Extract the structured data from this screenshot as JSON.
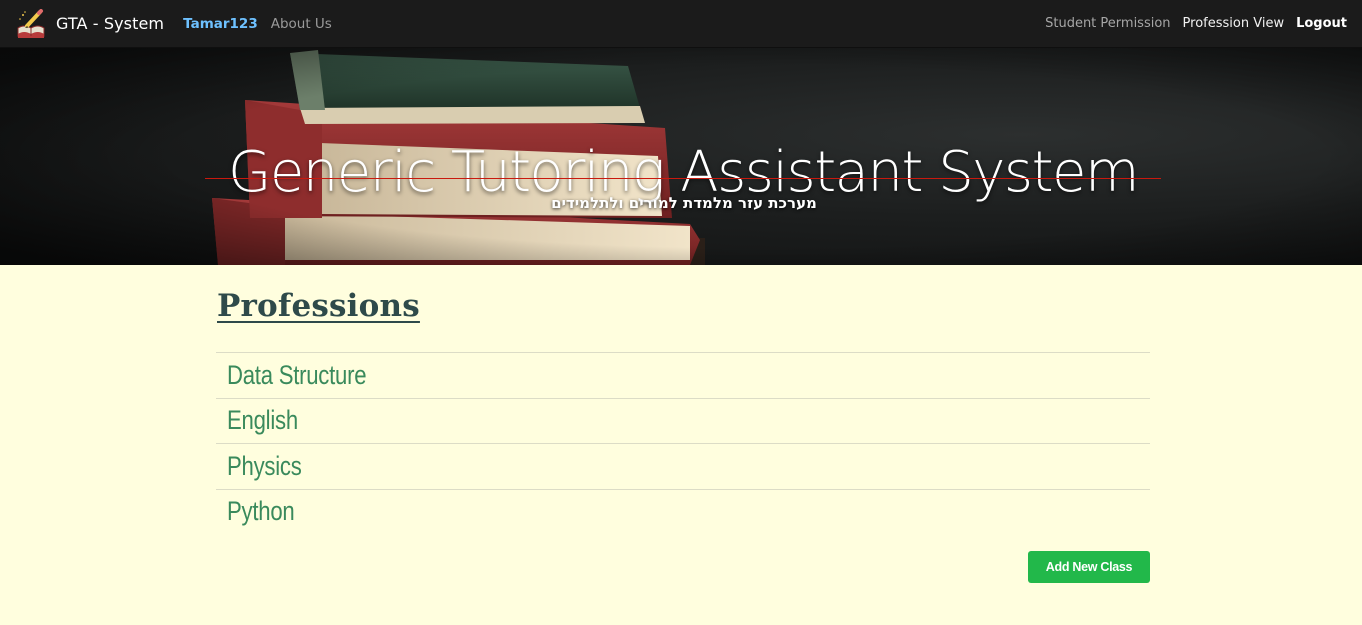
{
  "navbar": {
    "brand": "GTA - System",
    "user": "Tamar123",
    "about": "About Us",
    "links": [
      "Student Permission",
      "Profession View",
      "Logout"
    ]
  },
  "hero": {
    "title": "Generic Tutoring Assistant System",
    "subtitle": "מערכת עזר מלמדת למורים ולתלמידים"
  },
  "main": {
    "heading": "Professions",
    "professions": [
      "Data Structure",
      "English",
      "Physics",
      "Python"
    ],
    "add_button": "Add New Class"
  },
  "colors": {
    "page_background": "#fffede",
    "navbar_background": "#1b1b1b",
    "user_link": "#6ec1ff",
    "heading": "#2e4a4a",
    "profession_text": "#3a8a5c",
    "add_button": "#22b84a",
    "hero_rule": "#c9190e"
  }
}
